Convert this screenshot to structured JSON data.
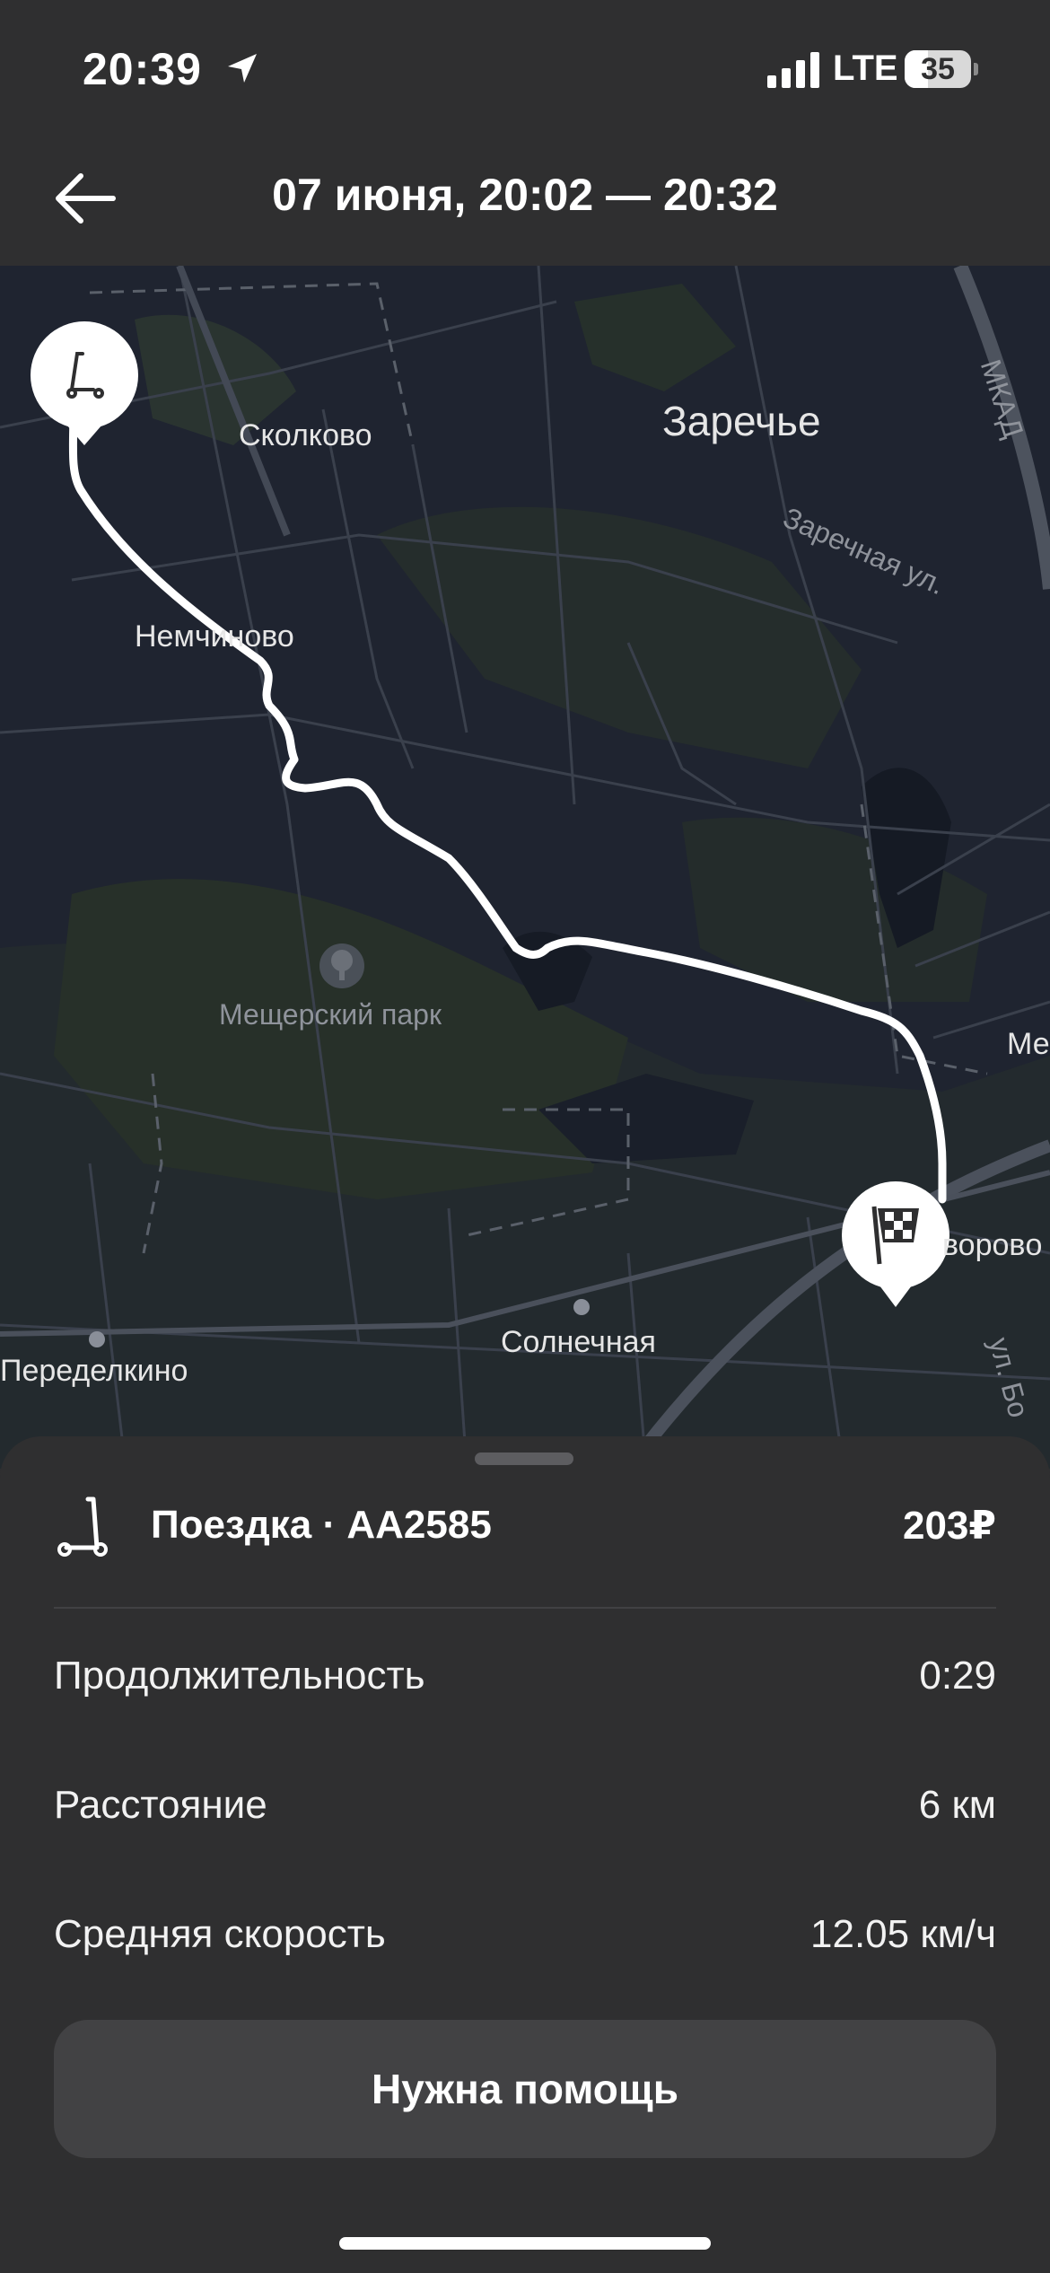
{
  "status_bar": {
    "time": "20:39",
    "network": "LTE",
    "battery": "35",
    "battery_level_percent": 35
  },
  "header": {
    "title": "07 июня, 20:02 — 20:32",
    "back_icon": "arrow-left-icon"
  },
  "map": {
    "labels": {
      "skolkovo": "Сколково",
      "zarechye": "Заречье",
      "zarechnaya": "Заречная ул.",
      "mkad": "МКАД",
      "nemchinovo": "Немчиново",
      "meshchersky": "Мещерский парк",
      "me": "Ме",
      "borovo": "воровo",
      "peredelkino": "Переделкино",
      "solnechnaya": "Солнечная",
      "street_right": "ул. Бо"
    },
    "start_icon": "scooter-icon",
    "finish_icon": "checkered-flag-icon"
  },
  "trip": {
    "title": "Поездка · AA2585",
    "price": "203₽",
    "icon": "scooter-icon",
    "stats": [
      {
        "label": "Продолжительность",
        "value": "0:29"
      },
      {
        "label": "Расстояние",
        "value": "6 км"
      },
      {
        "label": "Средняя скорость",
        "value": "12.05 км/ч"
      }
    ],
    "help_button": "Нужна помощь"
  },
  "colors": {
    "background": "#2f2f30",
    "map_background": "#1f2430",
    "route": "#ffffff",
    "button": "#424244"
  }
}
